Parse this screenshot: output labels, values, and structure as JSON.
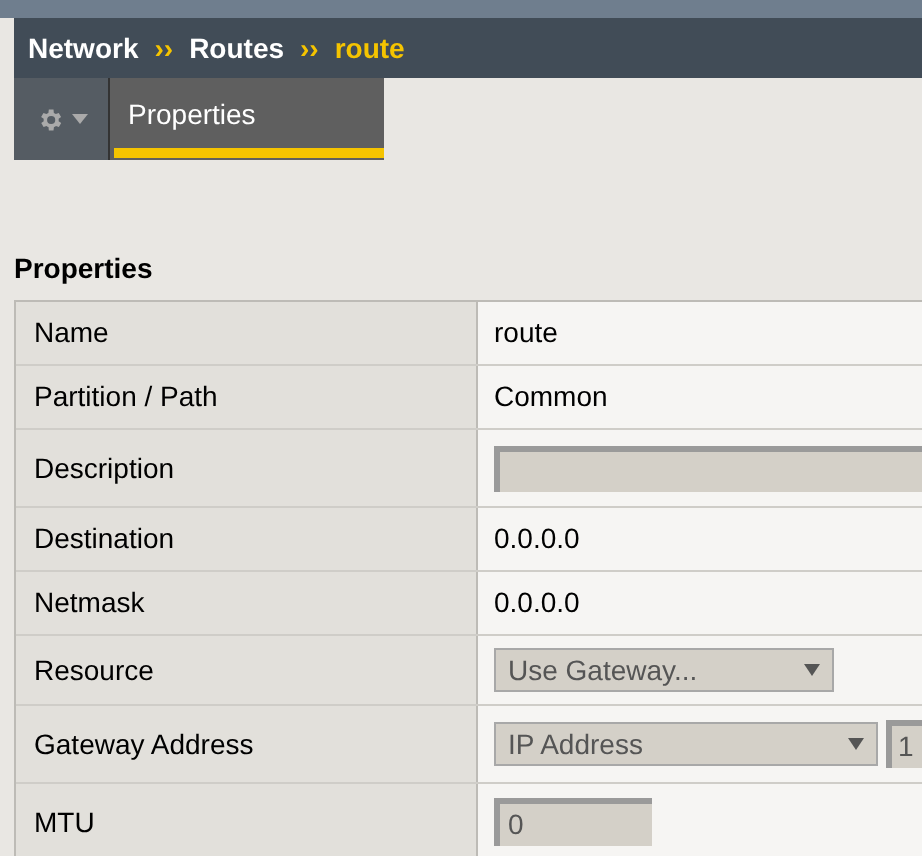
{
  "breadcrumb": [
    {
      "label": "Network",
      "current": false
    },
    {
      "label": "Routes",
      "current": false
    },
    {
      "label": "route",
      "current": true
    }
  ],
  "breadcrumb_separator": "››",
  "tabs": [
    {
      "label": "Properties",
      "selected": true
    }
  ],
  "section_title": "Properties",
  "rows": [
    {
      "label": "Name",
      "kind": "text",
      "value": "route"
    },
    {
      "label": "Partition / Path",
      "kind": "text",
      "value": "Common"
    },
    {
      "label": "Description",
      "kind": "input"
    },
    {
      "label": "Destination",
      "kind": "text",
      "value": "0.0.0.0"
    },
    {
      "label": "Netmask",
      "kind": "text",
      "value": "0.0.0.0"
    },
    {
      "label": "Resource",
      "kind": "select",
      "value": "Use Gateway..."
    },
    {
      "label": "Gateway Address",
      "kind": "select_input",
      "value": "IP Address",
      "input_value": "1"
    },
    {
      "label": "MTU",
      "kind": "short_input",
      "input_value": "0"
    }
  ]
}
